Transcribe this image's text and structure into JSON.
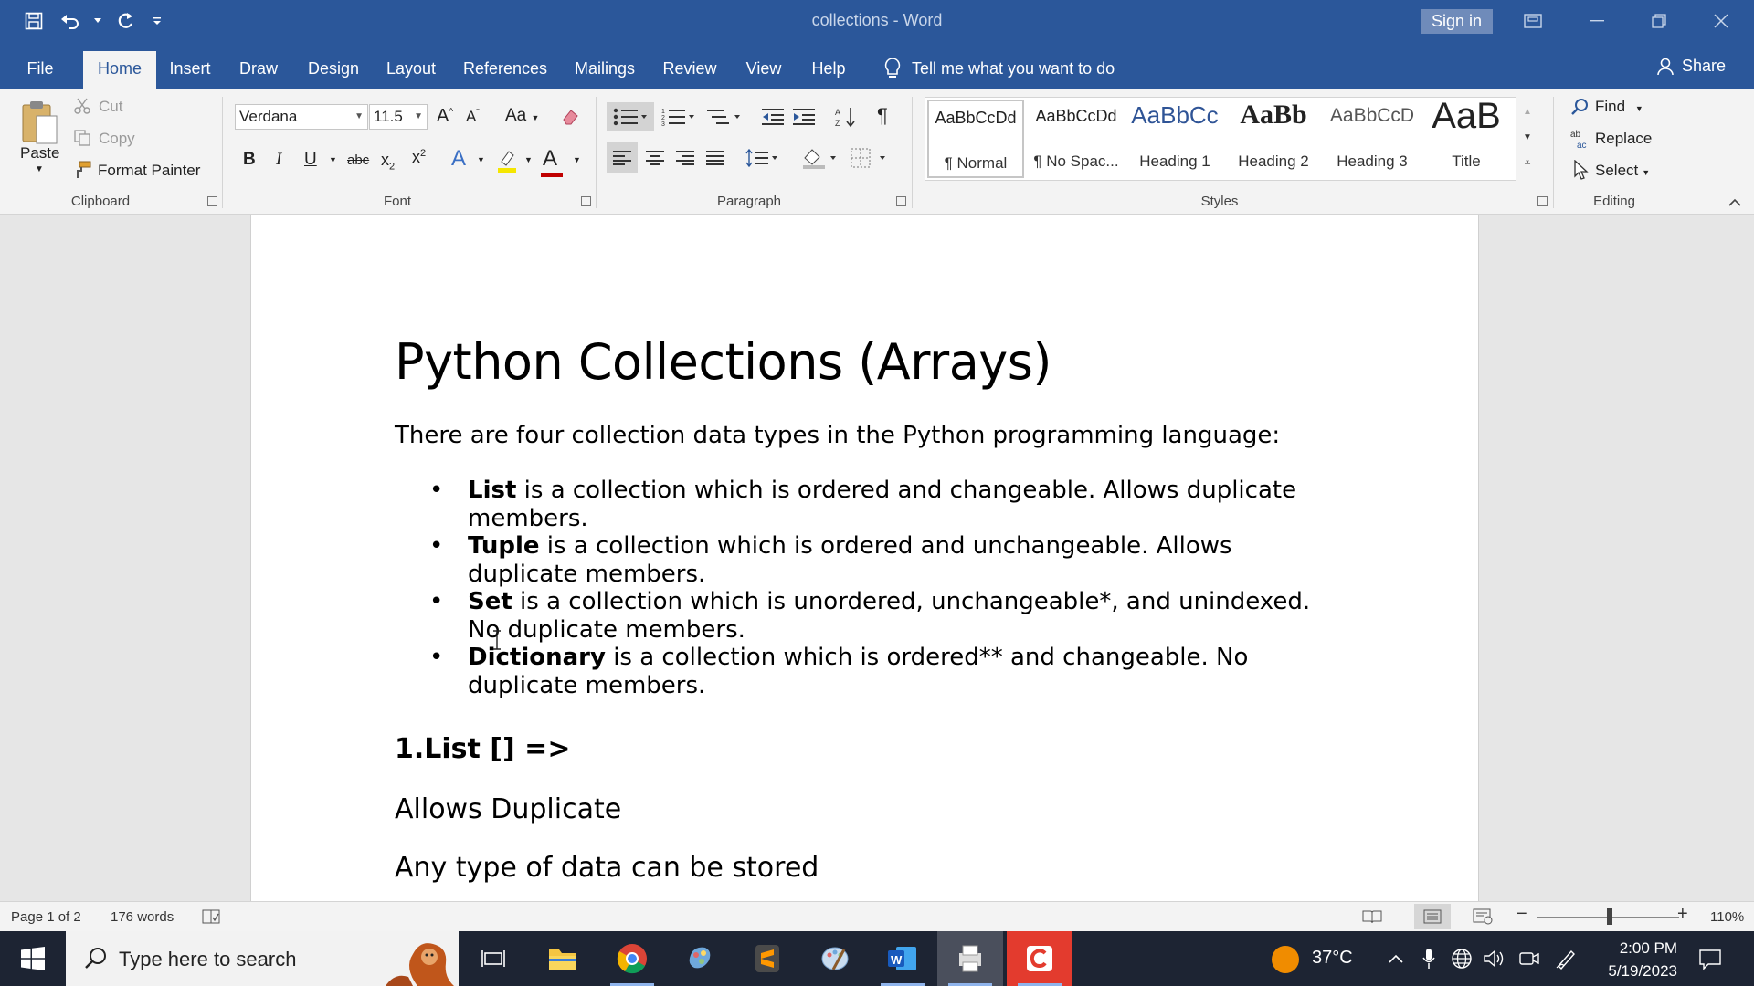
{
  "titlebar": {
    "doc_title": "collections  -  Word",
    "signin_label": "Sign in"
  },
  "tabs": [
    {
      "label": "File"
    },
    {
      "label": "Home"
    },
    {
      "label": "Insert"
    },
    {
      "label": "Draw"
    },
    {
      "label": "Design"
    },
    {
      "label": "Layout"
    },
    {
      "label": "References"
    },
    {
      "label": "Mailings"
    },
    {
      "label": "Review"
    },
    {
      "label": "View"
    },
    {
      "label": "Help"
    }
  ],
  "tellme": "Tell me what you want to do",
  "share": "Share",
  "clipboard": {
    "paste": "Paste",
    "cut": "Cut",
    "copy": "Copy",
    "format_painter": "Format Painter",
    "group_label": "Clipboard"
  },
  "font": {
    "family": "Verdana",
    "size": "11.5",
    "case_label": "Aa",
    "group_label": "Font"
  },
  "paragraph": {
    "group_label": "Paragraph"
  },
  "styles": {
    "items": [
      {
        "sample": "AaBbCcDd",
        "name": "¶ Normal"
      },
      {
        "sample": "AaBbCcDd",
        "name": "¶ No Spac..."
      },
      {
        "sample": "AaBbCc",
        "name": "Heading 1"
      },
      {
        "sample": "AaBb",
        "name": "Heading 2"
      },
      {
        "sample": "AaBbCcD",
        "name": "Heading 3"
      },
      {
        "sample": "AaB",
        "name": "Title"
      }
    ],
    "group_label": "Styles"
  },
  "editing": {
    "find": "Find",
    "replace": "Replace",
    "select": "Select",
    "group_label": "Editing"
  },
  "document": {
    "title": "Python Collections (Arrays)",
    "intro": "There are four collection data types in the Python programming language:",
    "bullets": [
      {
        "term": "List",
        "text": " is a collection which is ordered and changeable. Allows duplicate members."
      },
      {
        "term": "Tuple",
        "text": " is a collection which is ordered and unchangeable. Allows duplicate members."
      },
      {
        "term": "Set",
        "text": " is a collection which is unordered, unchangeable*, and unindexed. No duplicate members."
      },
      {
        "term": "Dictionary",
        "text": " is a collection which is ordered** and changeable. No duplicate members."
      }
    ],
    "heading2": "1.List [] =>",
    "para1": "Allows Duplicate",
    "para2": "Any type of data can be stored"
  },
  "status": {
    "page": "Page 1 of 2",
    "words": "176 words",
    "zoom": "110%",
    "zoom_percent": 110
  },
  "taskbar": {
    "search_placeholder": "Type here to search",
    "temperature": "37°C",
    "time": "2:00 PM",
    "date": "5/19/2023"
  },
  "colors": {
    "word_blue": "#2b579a",
    "ribbon_bg": "#f3f3f3",
    "taskbar_bg": "#1d2433"
  }
}
